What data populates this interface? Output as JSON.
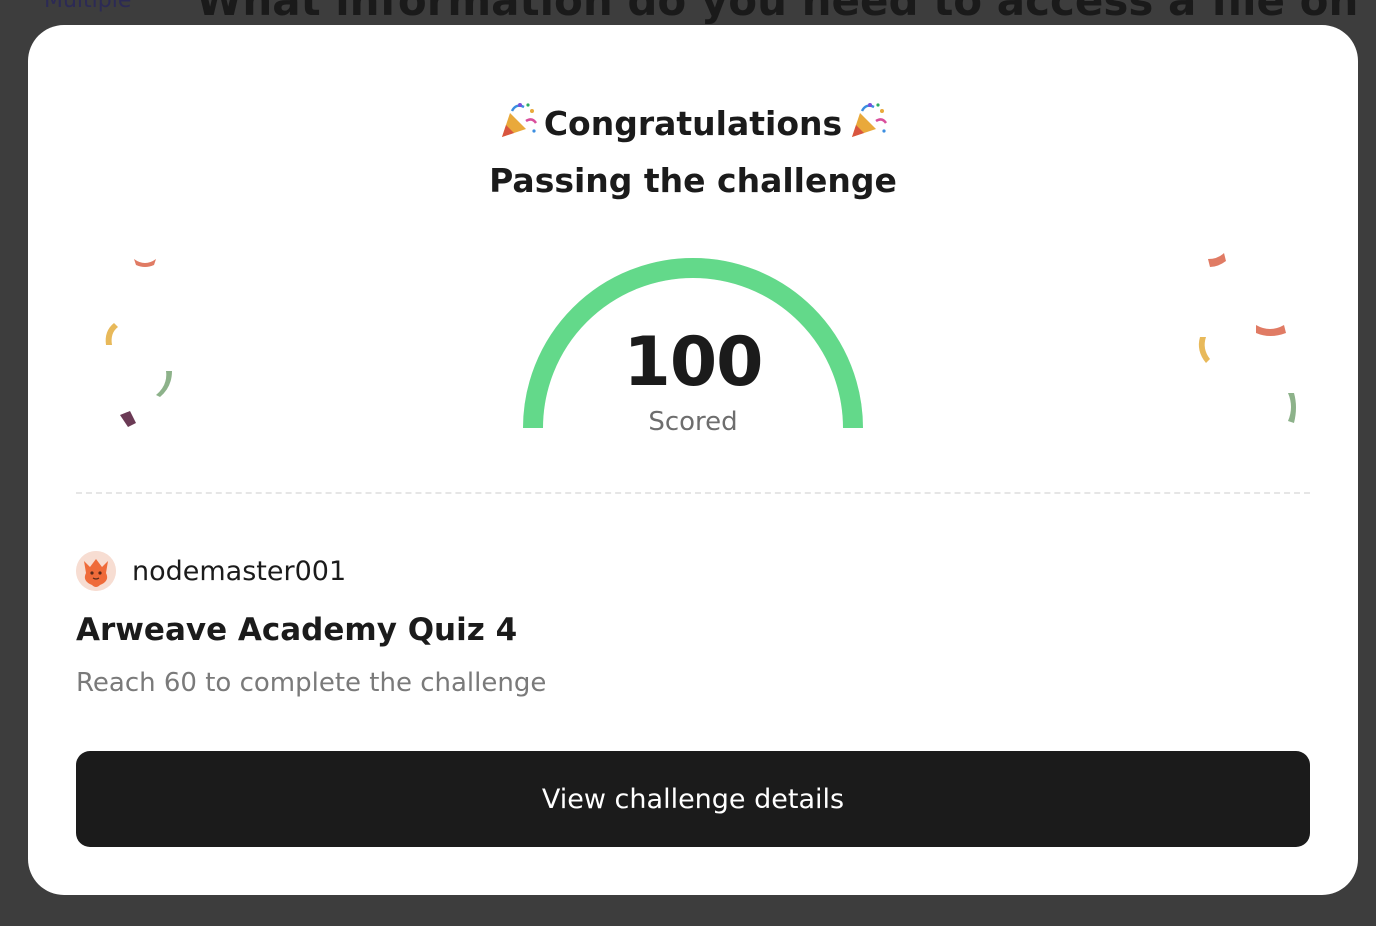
{
  "background": {
    "question_type": "Multiple",
    "question_text": "What information do you need to access a file on"
  },
  "modal": {
    "title": "Congratulations",
    "subtitle": "Passing the challenge",
    "score": {
      "value": "100",
      "label": "Scored",
      "progress_fraction": 1.0,
      "color": "#63d98a"
    },
    "user": {
      "username": "nodemaster001",
      "avatar_icon": "fox-avatar-icon"
    },
    "challenge": {
      "title": "Arweave Academy Quiz 4",
      "requirement": "Reach 60 to complete the challenge"
    },
    "button_label": "View challenge details",
    "icons": [
      "party-popper-icon",
      "party-popper-icon"
    ],
    "confetti_colors": [
      "#e07b64",
      "#e8b95a",
      "#8db28a",
      "#6b3a55"
    ]
  }
}
